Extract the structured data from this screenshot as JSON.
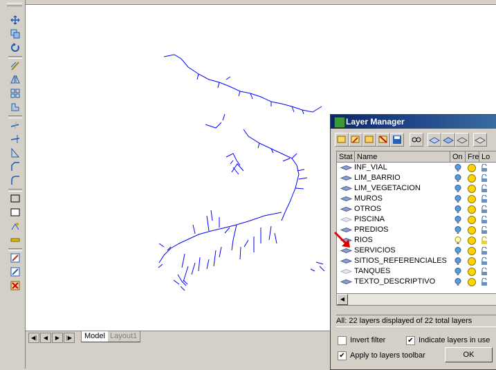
{
  "layer_manager": {
    "title": "Layer Manager",
    "columns": {
      "status": "Stat",
      "name": "Name",
      "on": "On",
      "freeze": "Fre",
      "lock": "Lo"
    },
    "layers": [
      {
        "name": "INF_VIAL",
        "state": "normal"
      },
      {
        "name": "LIM_BARRIO",
        "state": "normal"
      },
      {
        "name": "LIM_VEGETACION",
        "state": "normal"
      },
      {
        "name": "MUROS",
        "state": "normal"
      },
      {
        "name": "OTROS",
        "state": "normal"
      },
      {
        "name": "PISCINA",
        "state": "light"
      },
      {
        "name": "PREDIOS",
        "state": "normal"
      },
      {
        "name": "RIOS",
        "state": "selected"
      },
      {
        "name": "SERVICIOS",
        "state": "normal"
      },
      {
        "name": "SITIOS_REFERENCIALES",
        "state": "normal"
      },
      {
        "name": "TANQUES",
        "state": "light"
      },
      {
        "name": "TEXTO_DESCRIPTIVO",
        "state": "normal"
      }
    ],
    "summary": "All: 22 layers displayed of 22 total layers",
    "invert_filter": {
      "label": "Invert filter",
      "checked": false
    },
    "indicate_layers": {
      "label": "Indicate layers in use",
      "checked": true
    },
    "apply_toolbar": {
      "label": "Apply to layers toolbar",
      "checked": true
    },
    "ok_label": "OK"
  },
  "tabs": {
    "model": "Model",
    "layout1": "Layout1"
  },
  "colors": {
    "drawing_line": "#0000ff",
    "titlebar": "#0a246a",
    "pointer_arrow": "#e00000",
    "bulb": "#5b9bd5",
    "sun": "#ffd400"
  },
  "toolbar_icons": [
    "move-icon",
    "copy-icon",
    "rotate-icon",
    "offset-icon",
    "mirror-icon",
    "array-icon",
    "stretch-icon",
    "trim-icon",
    "extend-icon",
    "break-icon",
    "chamfer-icon",
    "fillet-icon",
    "rectangle-icon",
    "region-icon",
    "explode-icon",
    "measure-icon",
    "edit-text-icon",
    "edit-attribute-icon",
    "erase-icon"
  ]
}
